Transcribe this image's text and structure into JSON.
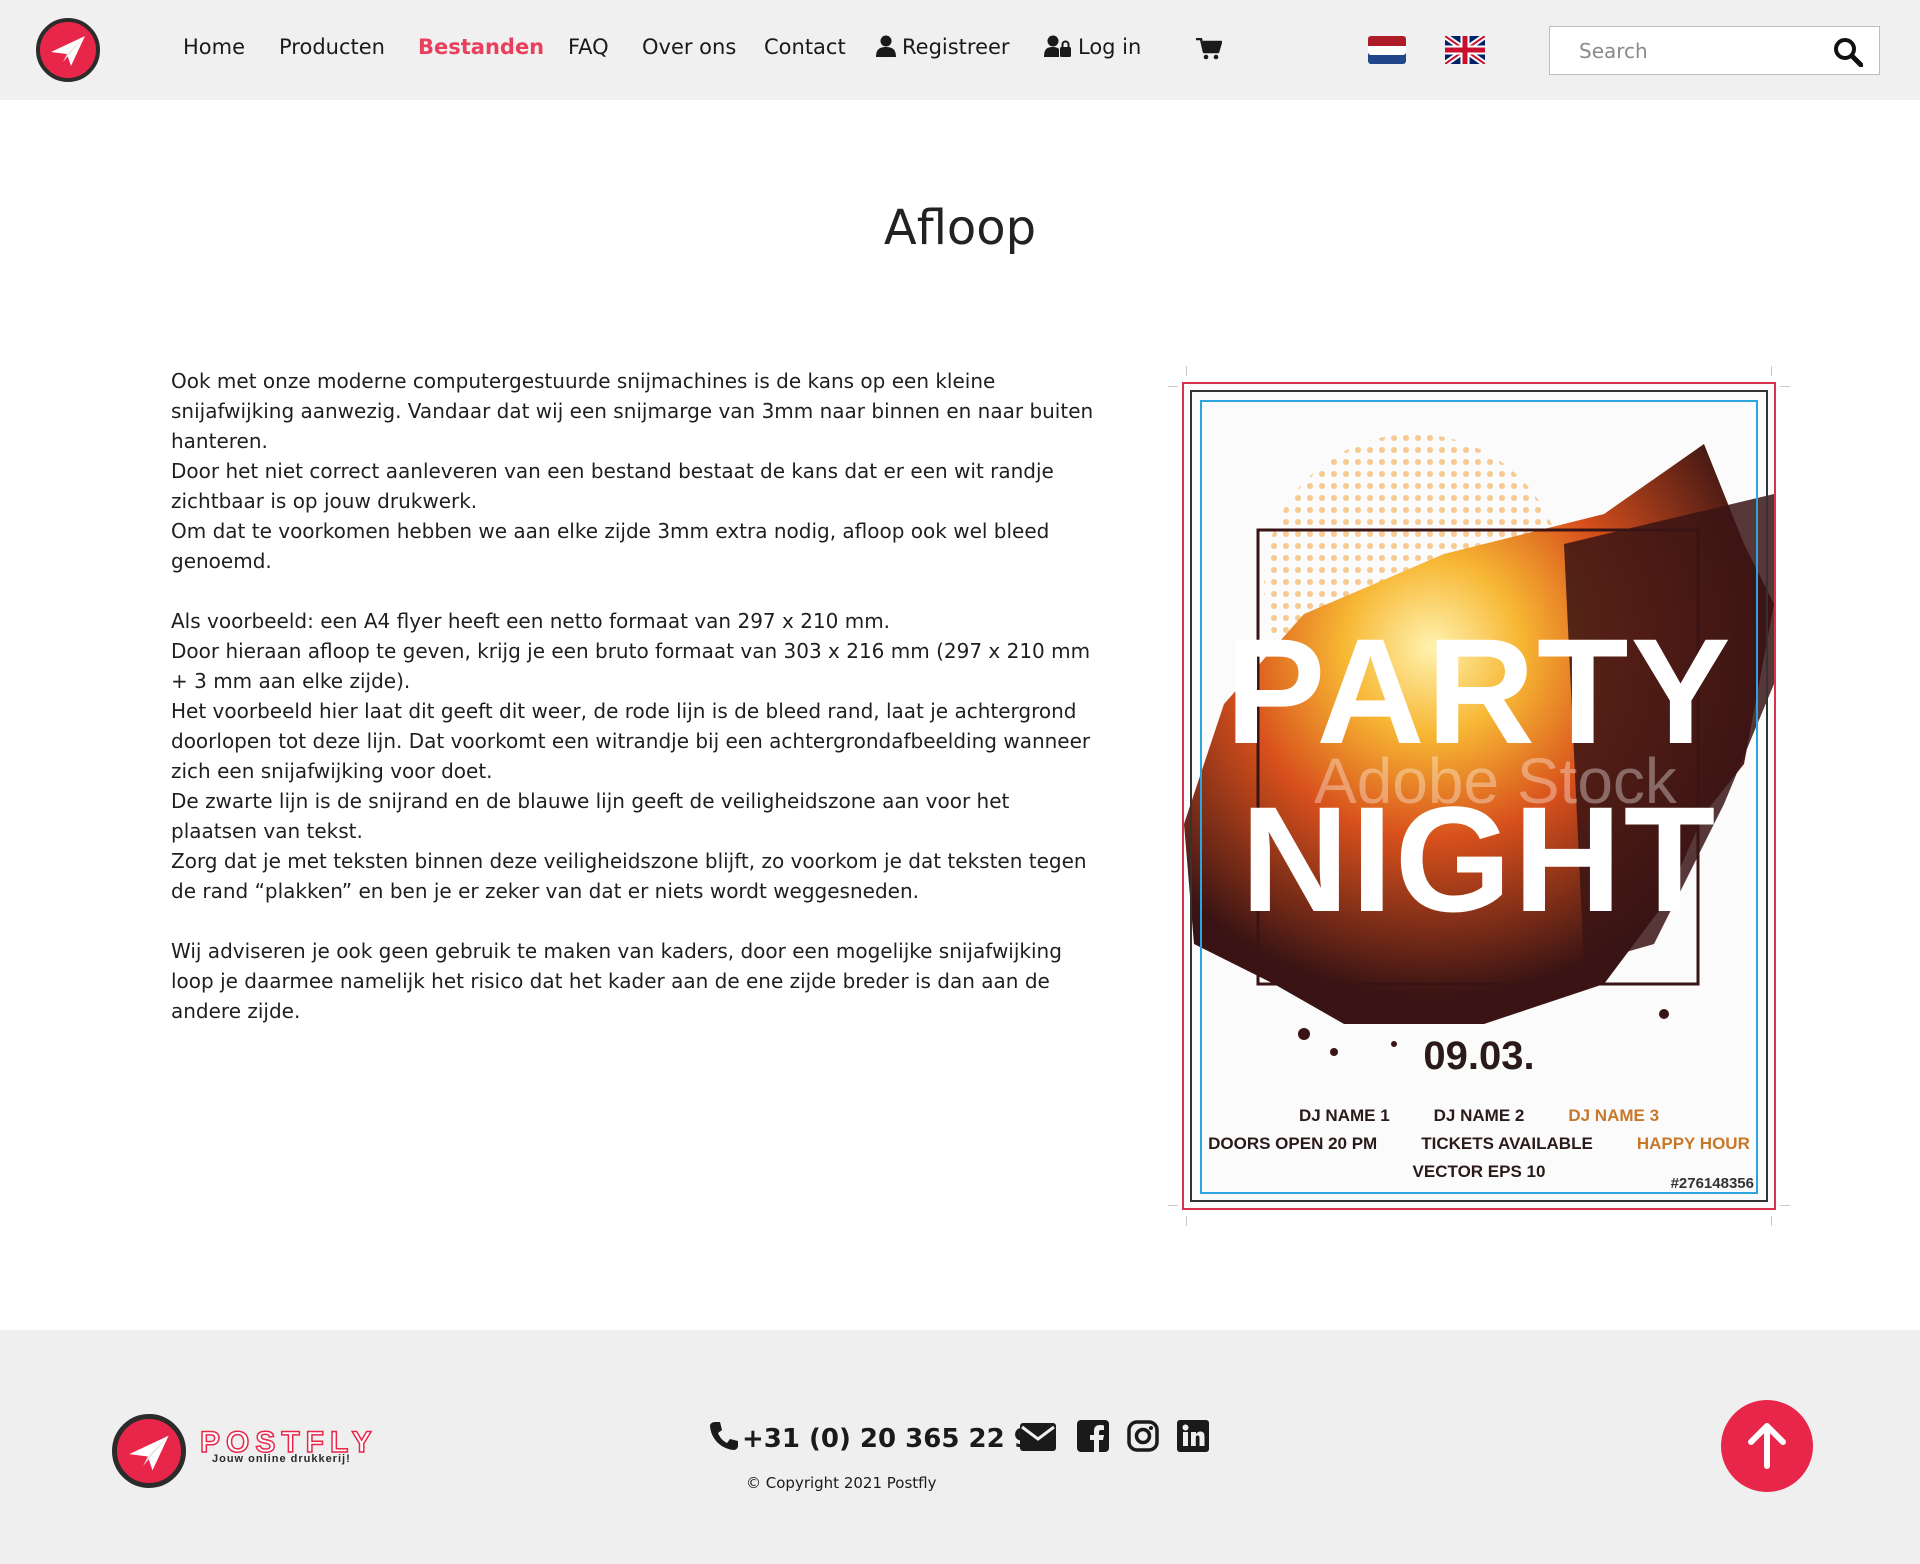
{
  "header": {
    "nav": [
      {
        "label": "Home"
      },
      {
        "label": "Producten"
      },
      {
        "label": "Bestanden",
        "active": true
      },
      {
        "label": "FAQ"
      },
      {
        "label": "Over ons"
      },
      {
        "label": "Contact"
      },
      {
        "label": "Registreer",
        "icon": "user-icon"
      },
      {
        "label": "Log in",
        "icon": "user-lock-icon"
      }
    ],
    "cart_icon": "shopping-cart-icon",
    "languages": [
      {
        "code": "nl",
        "icon": "dutch-flag-icon"
      },
      {
        "code": "en",
        "icon": "uk-flag-icon"
      }
    ],
    "search": {
      "placeholder": "Search",
      "value": "",
      "icon": "search-icon"
    }
  },
  "main": {
    "title": "Afloop",
    "paragraphs": [
      [
        "Ook met onze moderne computergestuurde snijmachines is de kans op een kleine snijafwijking aanwezig. Vandaar dat wij een snijmarge van 3mm naar binnen en naar buiten hanteren.",
        "Door het niet correct aanleveren van een bestand bestaat de kans dat er een wit randje zichtbaar is op jouw drukwerk.",
        "Om dat te voorkomen hebben we aan elke zijde 3mm extra nodig, afloop ook wel bleed genoemd."
      ],
      [
        "Als voorbeeld: een A4 flyer heeft een netto formaat van 297 x 210 mm.",
        "Door hieraan afloop te geven, krijg je een bruto formaat van 303 x 216 mm (297 x 210 mm + 3 mm aan elke zijde).",
        "Het voorbeeld hier laat dit geeft dit weer, de rode lijn is de bleed rand, laat je achtergrond doorlopen tot deze lijn. Dat voorkomt een witrandje bij een achtergrondafbeelding wanneer zich een snijafwijking voor doet.",
        "De zwarte lijn is de snijrand en de blauwe lijn geeft de veiligheidszone aan voor het plaatsen van tekst.",
        "Zorg dat je met teksten binnen deze veiligheidszone blijft, zo voorkom je dat teksten tegen de rand “plakken” en ben je er zeker van dat er niets wordt weggesneden."
      ],
      [
        "Wij adviseren je ook geen gebruik te maken van kaders, door een mogelijke snijafwijking loop je daarmee namelijk het risico dat het kader aan de ene zijde breder is dan aan de andere zijde."
      ]
    ],
    "flyer": {
      "line1": "PARTY",
      "line2": "NIGHT",
      "date": "09.03.",
      "djs": [
        "DJ NAME 1",
        "DJ NAME 2",
        "DJ NAME 3"
      ],
      "info": [
        "DOORS OPEN 20 PM",
        "TICKETS AVAILABLE",
        "HAPPY HOUR"
      ],
      "vector": "VECTOR  EPS 10",
      "stock_id": "#276148356",
      "watermark": "Adobe Stock",
      "colors": {
        "bleed": "#d6334a",
        "trim": "#333333",
        "safe": "#2aa5e0"
      }
    }
  },
  "footer": {
    "brand": "POSTFLY",
    "tagline": "Jouw online drukkerij!",
    "phone": "+31 (0) 20 365 22 93",
    "social_icons": [
      "mail-icon",
      "facebook-icon",
      "instagram-icon",
      "linkedin-icon"
    ],
    "copyright": "© Copyright 2021 Postfly"
  },
  "colors": {
    "accent": "#e8264a",
    "active_nav": "#e8405d",
    "header_bg": "#f0f0f0",
    "footer_bg": "#efefef"
  }
}
